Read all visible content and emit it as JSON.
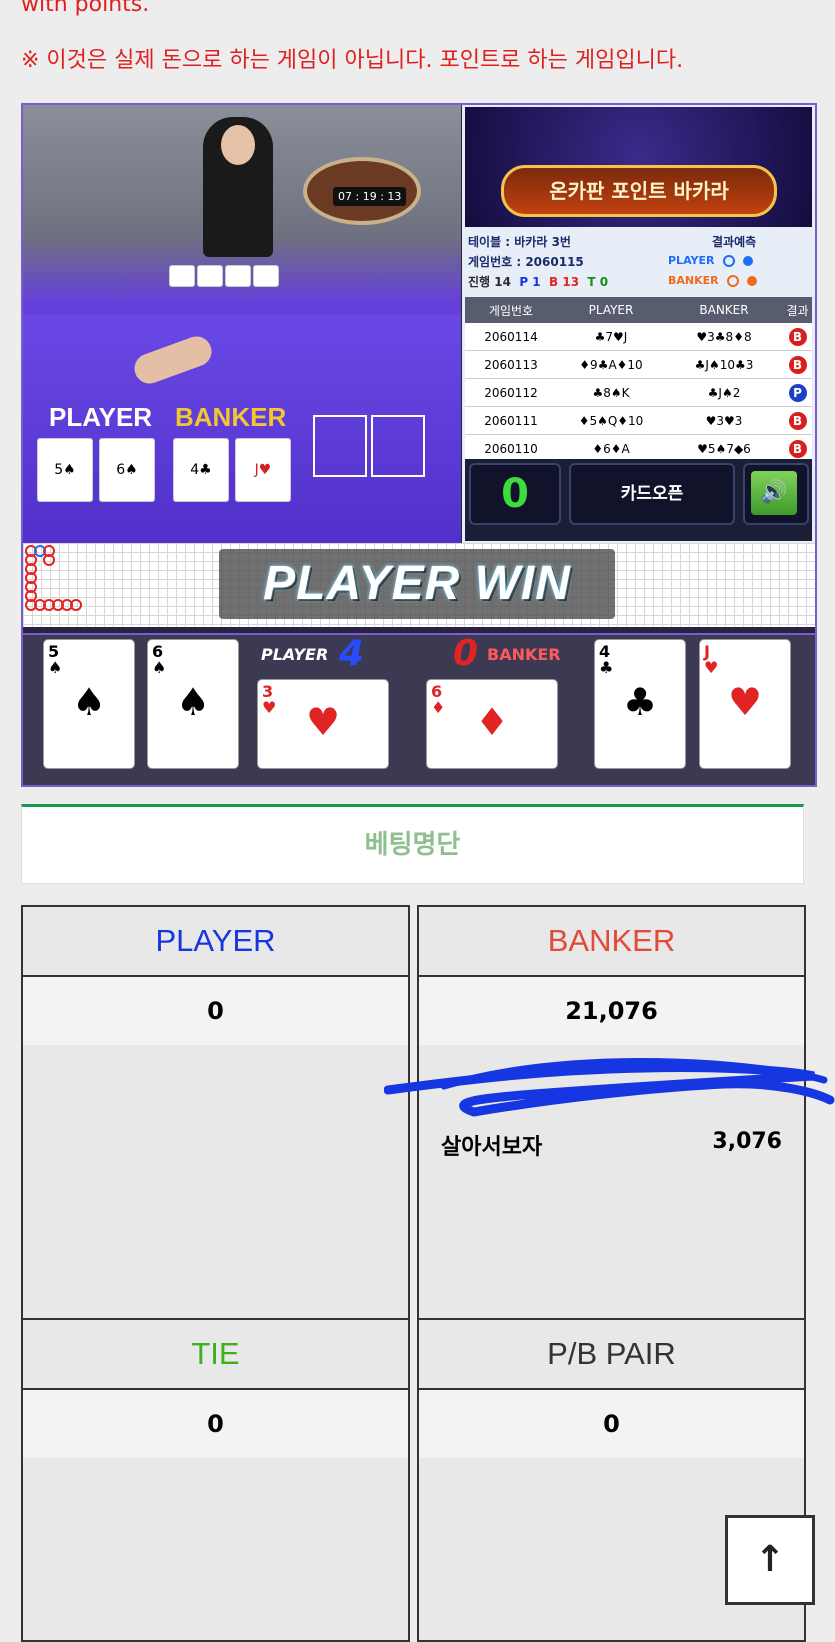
{
  "notice": {
    "english_tail": "with points.",
    "korean": "※ 이것은 실제 돈으로 하는 게임이 아닙니다. 포인트로 하는 게임입니다."
  },
  "video": {
    "clock": "07 : 19 : 13",
    "label_player": "PLAYER",
    "label_banker": "BANKER"
  },
  "panel": {
    "banner_title": "온카판 포인트 바카라",
    "table": "테이블 : 바카라 3번",
    "game_no": "게임번호 : 2060115",
    "progress": "진행 14",
    "p_count": "P 1",
    "b_count": "B 13",
    "t_count": "T 0",
    "predict_label": "결과예측",
    "predict_player": "PLAYER",
    "predict_banker": "BANKER",
    "colors": {
      "player": "#1e6ef5",
      "banker": "#f06a1e",
      "tie": "#1a8a1a"
    }
  },
  "history": {
    "headers": [
      "게임번호",
      "PLAYER",
      "BANKER",
      "결과"
    ],
    "rows": [
      {
        "no": "2060114",
        "player": "♣7♥J",
        "banker": "♥3♣8♦8",
        "result": "B"
      },
      {
        "no": "2060113",
        "player": "♦9♣A♦10",
        "banker": "♣J♠10♣3",
        "result": "B"
      },
      {
        "no": "2060112",
        "player": "♣8♠K",
        "banker": "♣J♠2",
        "result": "P"
      },
      {
        "no": "2060111",
        "player": "♦5♠Q♦10",
        "banker": "♥3♥3",
        "result": "B"
      },
      {
        "no": "2060110",
        "player": "♦6♦A",
        "banker": "♥5♠7◆6",
        "result": "B"
      }
    ]
  },
  "controls": {
    "countdown": "0",
    "card_open": "카드오픈",
    "sound_icon": "speaker-icon"
  },
  "result": {
    "win_text": "PLAYER WIN",
    "player_label": "PLAYER",
    "player_score": "4",
    "banker_label": "BANKER",
    "banker_score": "0",
    "player_cards": [
      {
        "rank": "5",
        "suit": "♠",
        "red": false
      },
      {
        "rank": "6",
        "suit": "♠",
        "red": false
      },
      {
        "rank": "3",
        "suit": "♥",
        "red": true
      }
    ],
    "banker_cards": [
      {
        "rank": "6",
        "suit": "♦",
        "red": true
      },
      {
        "rank": "4",
        "suit": "♣",
        "red": false
      },
      {
        "rank": "J",
        "suit": "♥",
        "red": true
      }
    ]
  },
  "betting": {
    "title": "베팅명단",
    "player": {
      "label": "PLAYER",
      "total": "0",
      "color": "#1536e0"
    },
    "banker": {
      "label": "BANKER",
      "total": "21,076",
      "color": "#e04b3a",
      "entries": [
        {
          "name": "살아서보자",
          "amount": "3,076"
        }
      ]
    },
    "tie": {
      "label": "TIE",
      "total": "0",
      "color": "#3cb01e"
    },
    "pair": {
      "label": "P/B PAIR",
      "total": "0",
      "color": "#333333"
    }
  },
  "scroll_top_icon": "arrow-up-icon"
}
